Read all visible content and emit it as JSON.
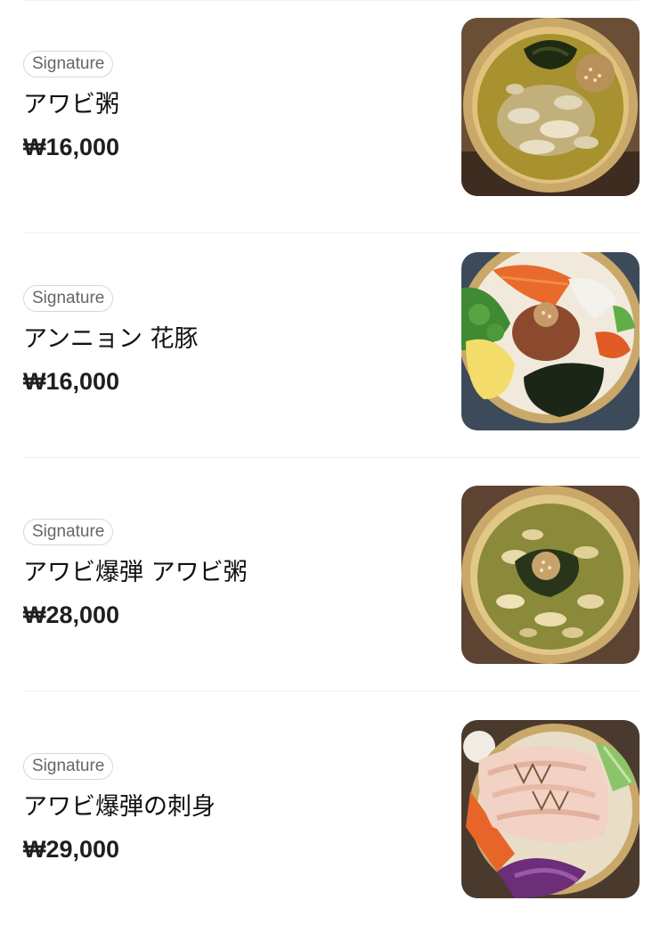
{
  "menu": {
    "items": [
      {
        "badge": "Signature",
        "name": "アワビ粥",
        "price": "₩16,000",
        "image": "abalone-porridge-photo"
      },
      {
        "badge": "Signature",
        "name": "アンニョン 花豚",
        "price": "₩16,000",
        "image": "bibimbap-bowl-photo"
      },
      {
        "badge": "Signature",
        "name": "アワビ爆弾 アワビ粥",
        "price": "₩28,000",
        "image": "abalone-bomb-porridge-photo"
      },
      {
        "badge": "Signature",
        "name": "アワビ爆弾の刺身",
        "price": "₩29,000",
        "image": "abalone-sashimi-photo"
      }
    ]
  }
}
